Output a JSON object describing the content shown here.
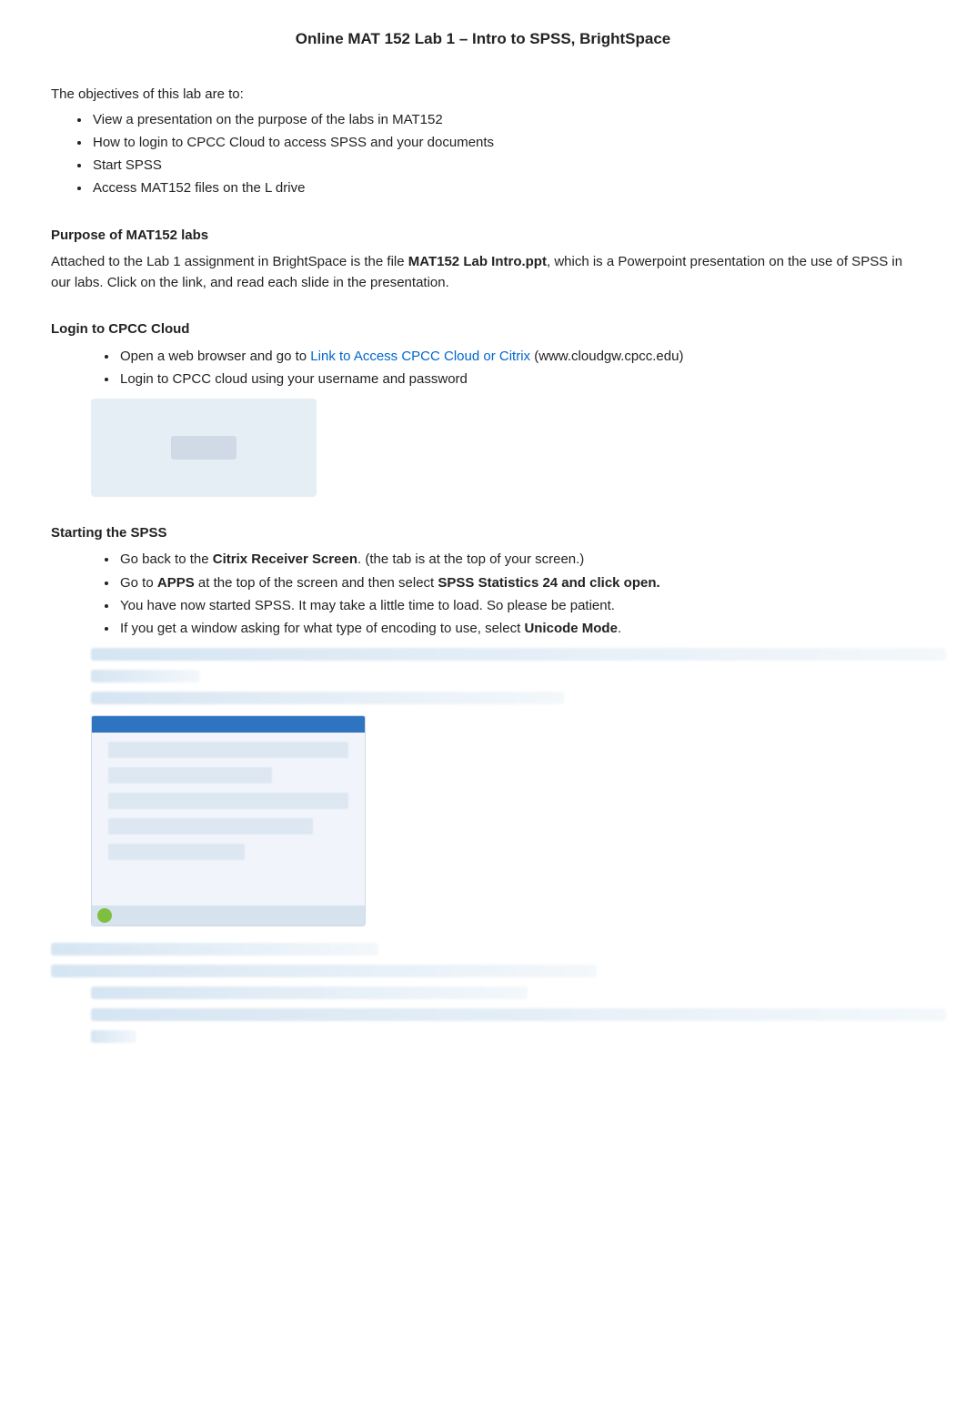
{
  "title": "Online MAT 152 Lab 1 – Intro to SPSS, BrightSpace",
  "objectives_intro": "The objectives of this lab are to:",
  "objectives": [
    "View a presentation on the purpose of the labs in MAT152",
    "How to login to CPCC Cloud to access SPSS and your documents",
    "Start SPSS",
    "Access MAT152 files on the L drive"
  ],
  "sections": {
    "purpose": {
      "heading": "Purpose of MAT152 labs",
      "para_pre": "Attached to the Lab 1 assignment in BrightSpace is the file ",
      "file_name": "MAT152 Lab Intro.ppt",
      "para_post": ", which is a Powerpoint presentation on the use of SPSS in our labs.  Click on the link, and read each slide in the presentation."
    },
    "login": {
      "heading": "Login to CPCC Cloud",
      "item1_pre": "Open a web browser and go to ",
      "item1_link": "Link to Access CPCC Cloud or Citrix",
      "item1_post": " (www.cloudgw.cpcc.edu)",
      "item2": "Login to CPCC cloud using your username and password"
    },
    "starting": {
      "heading": "Starting the SPSS",
      "item1_pre": "Go back to the ",
      "item1_bold": "Citrix Receiver Screen",
      "item1_post": ". (the tab is at the top of your screen.)",
      "item2_pre": "Go to ",
      "item2_bold1": "APPS",
      "item2_mid": " at the top of the screen and then select ",
      "item2_bold2": "SPSS Statistics 24 and click open.",
      "item3": "You have now started SPSS. It may take a little time to load. So please be patient.",
      "item4_pre": "If you get a window asking for what type of encoding to use, select ",
      "item4_bold": "Unicode Mode",
      "item4_post": "."
    }
  }
}
